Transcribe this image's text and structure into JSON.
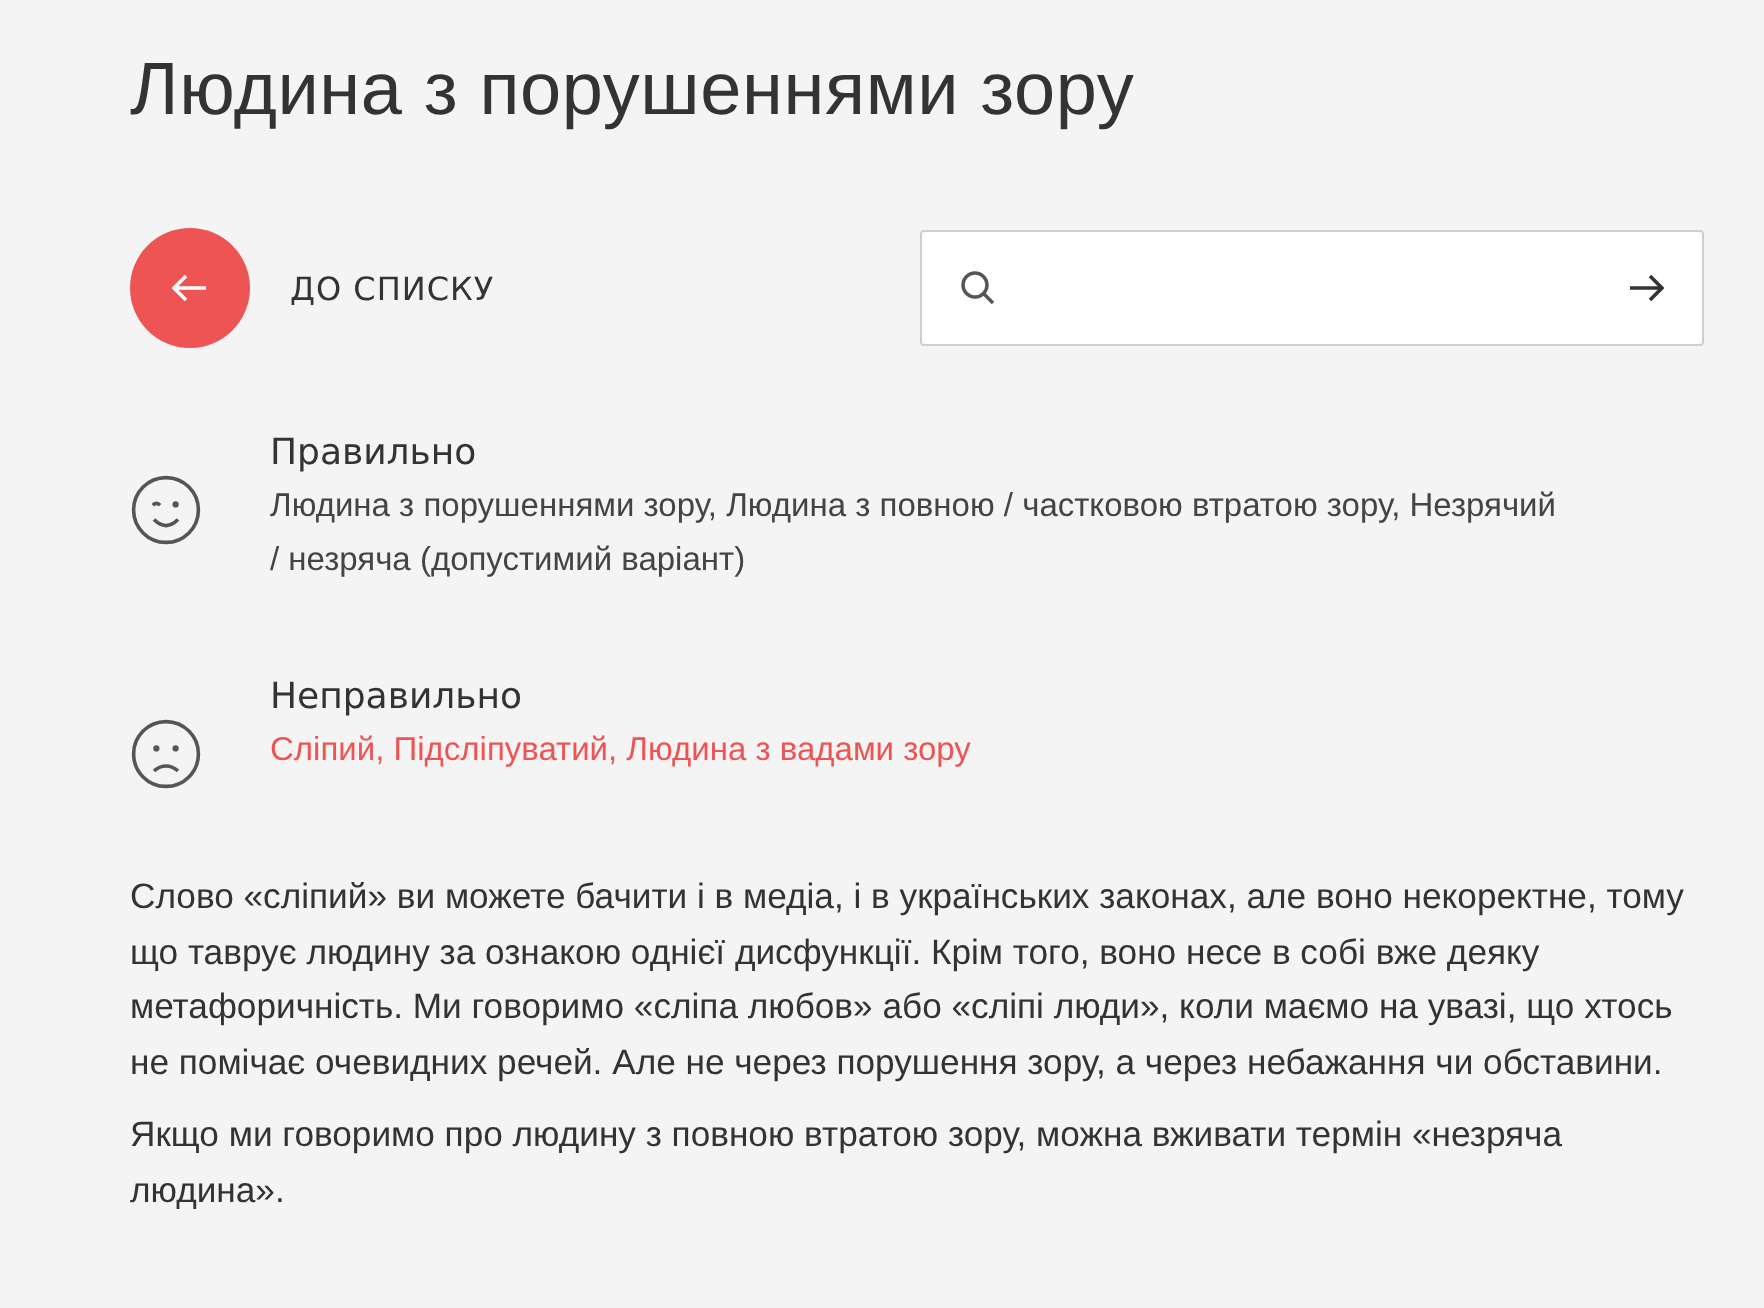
{
  "title": "Людина з порушеннями зору",
  "back_link": {
    "label": "ДО СПИСКУ"
  },
  "usages": [
    {
      "kind": "correct",
      "heading": "Правильно",
      "text": "Людина з порушеннями зору, Людина з повною / частковою втратою зору, Незрячий / незряча (допустимий варіант)"
    },
    {
      "kind": "incorrect",
      "heading": "Неправильно",
      "text": "Сліпий, Підсліпуватий, Людина з вадами зору"
    }
  ],
  "paragraphs": [
    "Слово «сліпий» ви можете бачити і в медіа, і в українських законах, але воно некоректне, тому що таврує людину за ознакою однієї дисфункції. Крім того, воно несе в собі вже деяку метафоричність. Ми говоримо «сліпа любов» або «сліпі люди», коли маємо на увазі, що хтось не помічає очевидних речей. Але не через порушення зору, а через небажання чи обставини.",
    "Якщо ми говоримо про людину з повною втратою зору, можна вживати термін «незряча людина»."
  ]
}
